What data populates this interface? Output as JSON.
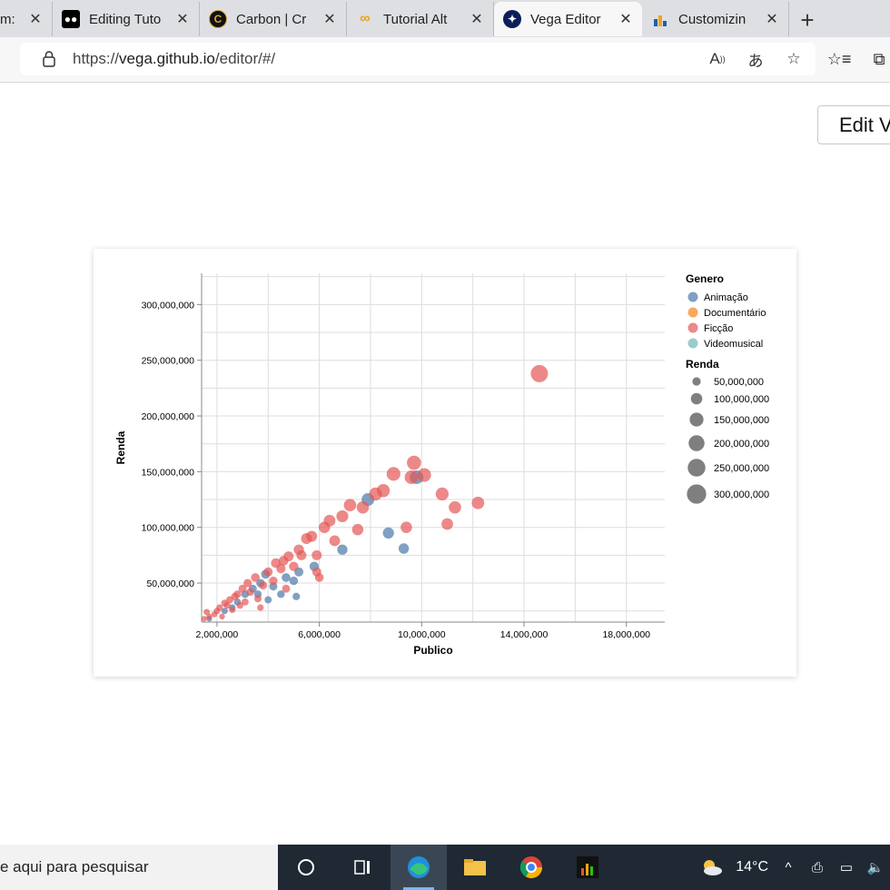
{
  "browser": {
    "tabs": [
      {
        "label": "m: ",
        "favicon": "generic-icon",
        "active": false
      },
      {
        "label": "Editing Tuto",
        "favicon": "medium-icon",
        "active": false
      },
      {
        "label": "Carbon | Cr",
        "favicon": "carbon-icon",
        "active": false
      },
      {
        "label": "Tutorial Alt",
        "favicon": "altair-icon",
        "active": false
      },
      {
        "label": "Vega Editor",
        "favicon": "vega-icon",
        "active": true
      },
      {
        "label": "Customizin",
        "favicon": "altair-docs-icon",
        "active": false
      }
    ],
    "address": {
      "scheme": "https://",
      "host": "vega.github.io",
      "path": "/editor/#/"
    }
  },
  "page": {
    "edit_button": "Edit V"
  },
  "chart_data": {
    "type": "scatter",
    "xlabel": "Publico",
    "ylabel": "Renda",
    "xlim": [
      1400000,
      19500000
    ],
    "ylim": [
      15000000,
      328000000
    ],
    "x_ticks": [
      "2,000,000",
      "6,000,000",
      "10,000,000",
      "14,000,000",
      "18,000,000"
    ],
    "y_ticks": [
      "50,000,000",
      "100,000,000",
      "150,000,000",
      "200,000,000",
      "250,000,000",
      "300,000,000"
    ],
    "grid": true,
    "legend_position": "right",
    "color_legend": {
      "title": "Genero",
      "entries": [
        {
          "label": "Animação",
          "color": "#4c78a8"
        },
        {
          "label": "Documentário",
          "color": "#f58518"
        },
        {
          "label": "Ficção",
          "color": "#e45756"
        },
        {
          "label": "Videomusical",
          "color": "#72b7b2"
        }
      ]
    },
    "size_legend": {
      "title": "Renda",
      "entries": [
        "50,000,000",
        "100,000,000",
        "150,000,000",
        "200,000,000",
        "250,000,000",
        "300,000,000"
      ]
    },
    "series": [
      {
        "name": "Animação",
        "points": [
          [
            1700000,
            18000000
          ],
          [
            2300000,
            25000000
          ],
          [
            2800000,
            33000000
          ],
          [
            3100000,
            40000000
          ],
          [
            3400000,
            45000000
          ],
          [
            3700000,
            50000000
          ],
          [
            3900000,
            58000000
          ],
          [
            4200000,
            47000000
          ],
          [
            4500000,
            40000000
          ],
          [
            4700000,
            55000000
          ],
          [
            5000000,
            52000000
          ],
          [
            5100000,
            38000000
          ],
          [
            5200000,
            60000000
          ],
          [
            5800000,
            65000000
          ],
          [
            6900000,
            80000000
          ],
          [
            7900000,
            125000000
          ],
          [
            8700000,
            95000000
          ],
          [
            9300000,
            81000000
          ],
          [
            9800000,
            145000000
          ],
          [
            3600000,
            40000000
          ],
          [
            4000000,
            35000000
          ],
          [
            2600000,
            28000000
          ]
        ]
      },
      {
        "name": "Ficção",
        "points": [
          [
            1500000,
            18000000
          ],
          [
            1700000,
            20000000
          ],
          [
            1900000,
            22000000
          ],
          [
            2000000,
            25000000
          ],
          [
            2100000,
            28000000
          ],
          [
            2200000,
            20000000
          ],
          [
            2400000,
            30000000
          ],
          [
            2500000,
            35000000
          ],
          [
            2600000,
            26000000
          ],
          [
            2700000,
            38000000
          ],
          [
            2800000,
            40000000
          ],
          [
            2900000,
            30000000
          ],
          [
            3000000,
            45000000
          ],
          [
            3100000,
            33000000
          ],
          [
            3200000,
            50000000
          ],
          [
            3300000,
            42000000
          ],
          [
            3500000,
            55000000
          ],
          [
            3600000,
            36000000
          ],
          [
            3800000,
            48000000
          ],
          [
            4000000,
            60000000
          ],
          [
            4200000,
            52000000
          ],
          [
            4300000,
            68000000
          ],
          [
            4500000,
            63000000
          ],
          [
            4600000,
            70000000
          ],
          [
            4800000,
            74000000
          ],
          [
            5000000,
            65000000
          ],
          [
            5200000,
            80000000
          ],
          [
            5300000,
            75000000
          ],
          [
            5500000,
            90000000
          ],
          [
            5700000,
            92000000
          ],
          [
            5900000,
            60000000
          ],
          [
            6000000,
            55000000
          ],
          [
            6200000,
            100000000
          ],
          [
            6400000,
            106000000
          ],
          [
            6600000,
            88000000
          ],
          [
            6900000,
            110000000
          ],
          [
            7200000,
            120000000
          ],
          [
            7500000,
            98000000
          ],
          [
            7700000,
            118000000
          ],
          [
            8200000,
            130000000
          ],
          [
            8500000,
            133000000
          ],
          [
            8900000,
            148000000
          ],
          [
            9400000,
            100000000
          ],
          [
            9600000,
            145000000
          ],
          [
            9700000,
            158000000
          ],
          [
            10100000,
            147000000
          ],
          [
            10800000,
            130000000
          ],
          [
            11000000,
            103000000
          ],
          [
            11300000,
            118000000
          ],
          [
            12200000,
            122000000
          ],
          [
            14600000,
            238000000
          ],
          [
            5900000,
            75000000
          ],
          [
            4700000,
            45000000
          ],
          [
            3700000,
            28000000
          ],
          [
            2300000,
            32000000
          ],
          [
            1600000,
            24000000
          ]
        ]
      }
    ]
  },
  "taskbar": {
    "search_text": "e aqui para pesquisar",
    "temperature": "14°C"
  }
}
